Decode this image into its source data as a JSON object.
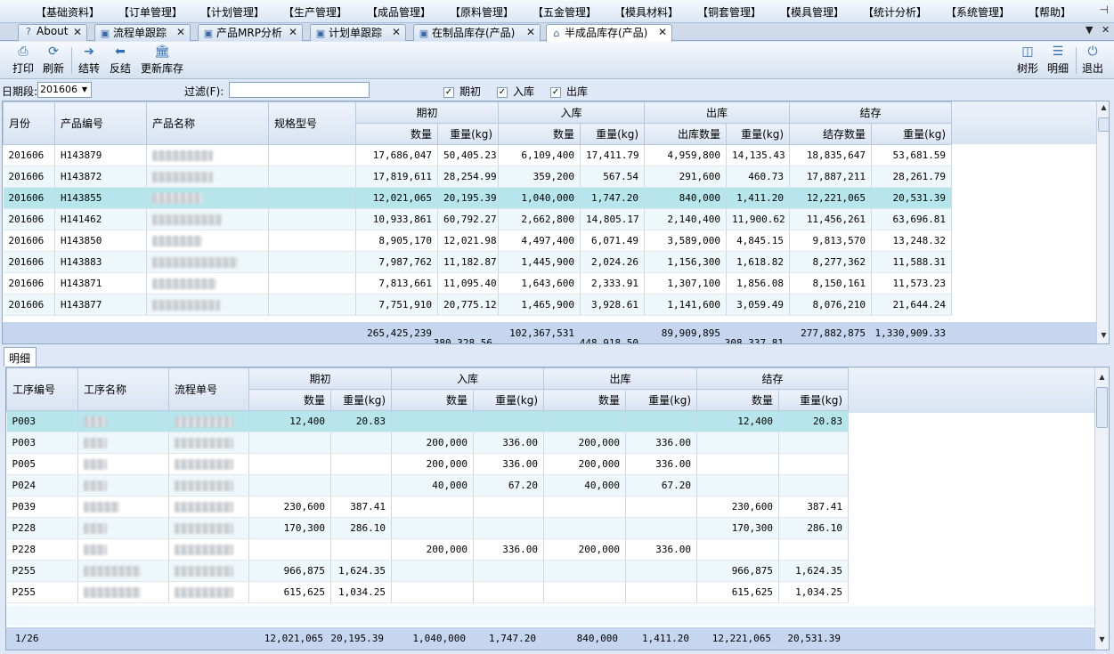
{
  "menu": [
    "【基础资料】",
    "【订单管理】",
    "【计划管理】",
    "【生产管理】",
    "【成品管理】",
    "【原料管理】",
    "【五金管理】",
    "【模具材料】",
    "【铜套管理】",
    "【模具管理】",
    "【统计分析】",
    "【系统管理】",
    "【帮助】"
  ],
  "menu_pin": "⊣",
  "tabs": [
    {
      "label": "About",
      "icon": "help-icon"
    },
    {
      "label": "流程单跟踪",
      "icon": "window-icon"
    },
    {
      "label": "产品MRP分析",
      "icon": "window-icon"
    },
    {
      "label": "计划单跟踪",
      "icon": "window-icon"
    },
    {
      "label": "在制品库存(产品)",
      "icon": "window-icon"
    },
    {
      "label": "半成品库存(产品)",
      "icon": "home-icon"
    }
  ],
  "toolbar": {
    "print": "打印",
    "refresh": "刷新",
    "carry": "结转",
    "reverse": "反结",
    "update": "更新库存",
    "tree": "树形",
    "detail": "明细",
    "exit": "退出"
  },
  "filter": {
    "period_label": "日期段:",
    "period_value": "201606",
    "filter_label": "过滤(F):",
    "filter_value": "",
    "chk_begin": "期初",
    "chk_in": "入库",
    "chk_out": "出库"
  },
  "top_grid": {
    "headers": {
      "month": "月份",
      "code": "产品编号",
      "name": "产品名称",
      "spec": "规格型号",
      "begin": "期初",
      "in": "入库",
      "out": "出库",
      "balance": "结存",
      "qty": "数量",
      "weight": "重量(kg)",
      "out_qty": "出库数量",
      "bal_qty": "结存数量"
    },
    "rows": [
      {
        "month": "201606",
        "code": "H143879",
        "bq": "17,686,047",
        "bw": "50,405.23",
        "iq": "6,109,400",
        "iw": "17,411.79",
        "oq": "4,959,800",
        "ow": "14,135.43",
        "sq": "18,835,647",
        "sw": "53,681.59",
        "nw": 68
      },
      {
        "month": "201606",
        "code": "H143872",
        "bq": "17,819,611",
        "bw": "28,254.99",
        "iq": "359,200",
        "iw": "567.54",
        "oq": "291,600",
        "ow": "460.73",
        "sq": "17,887,211",
        "sw": "28,261.79",
        "nw": 68
      },
      {
        "month": "201606",
        "code": "H143855",
        "bq": "12,021,065",
        "bw": "20,195.39",
        "iq": "1,040,000",
        "iw": "1,747.20",
        "oq": "840,000",
        "ow": "1,411.20",
        "sq": "12,221,065",
        "sw": "20,531.39",
        "nw": 56
      },
      {
        "month": "201606",
        "code": "H141462",
        "bq": "10,933,861",
        "bw": "60,792.27",
        "iq": "2,662,800",
        "iw": "14,805.17",
        "oq": "2,140,400",
        "ow": "11,900.62",
        "sq": "11,456,261",
        "sw": "63,696.81",
        "nw": 78
      },
      {
        "month": "201606",
        "code": "H143850",
        "bq": "8,905,170",
        "bw": "12,021.98",
        "iq": "4,497,400",
        "iw": "6,071.49",
        "oq": "3,589,000",
        "ow": "4,845.15",
        "sq": "9,813,570",
        "sw": "13,248.32",
        "nw": 56
      },
      {
        "month": "201606",
        "code": "H143883",
        "bq": "7,987,762",
        "bw": "11,182.87",
        "iq": "1,445,900",
        "iw": "2,024.26",
        "oq": "1,156,300",
        "ow": "1,618.82",
        "sq": "8,277,362",
        "sw": "11,588.31",
        "nw": 96
      },
      {
        "month": "201606",
        "code": "H143871",
        "bq": "7,813,661",
        "bw": "11,095.40",
        "iq": "1,643,600",
        "iw": "2,333.91",
        "oq": "1,307,100",
        "ow": "1,856.08",
        "sq": "8,150,161",
        "sw": "11,573.23",
        "nw": 72
      },
      {
        "month": "201606",
        "code": "H143877",
        "bq": "7,751,910",
        "bw": "20,775.12",
        "iq": "1,465,900",
        "iw": "3,928.61",
        "oq": "1,141,600",
        "ow": "3,059.49",
        "sq": "8,076,210",
        "sw": "21,644.24",
        "nw": 76
      }
    ],
    "totals": {
      "bq": "265,425,239",
      "bw": "380,328.56",
      "iq": "102,367,531",
      "iw": "448,918.50",
      "oq": "89,909,895",
      "ow": "308,337.81",
      "sq": "277,882,875",
      "sw": "1,330,909.33"
    }
  },
  "detail_tab": "明细",
  "bottom_grid": {
    "headers": {
      "proc_code": "工序编号",
      "proc_name": "工序名称",
      "flow_no": "流程单号",
      "begin": "期初",
      "in": "入库",
      "out": "出库",
      "balance": "结存",
      "qty": "数量",
      "weight": "重量(kg)"
    },
    "rows": [
      {
        "code": "P003",
        "bq": "12,400",
        "bw": "20.83",
        "iq": "",
        "iw": "",
        "oq": "",
        "ow": "",
        "sq": "12,400",
        "sw": "20.83",
        "nw": 26
      },
      {
        "code": "P003",
        "bq": "",
        "bw": "",
        "iq": "200,000",
        "iw": "336.00",
        "oq": "200,000",
        "ow": "336.00",
        "sq": "",
        "sw": "",
        "nw": 26
      },
      {
        "code": "P005",
        "bq": "",
        "bw": "",
        "iq": "200,000",
        "iw": "336.00",
        "oq": "200,000",
        "ow": "336.00",
        "sq": "",
        "sw": "",
        "nw": 26
      },
      {
        "code": "P024",
        "bq": "",
        "bw": "",
        "iq": "40,000",
        "iw": "67.20",
        "oq": "40,000",
        "ow": "67.20",
        "sq": "",
        "sw": "",
        "nw": 26
      },
      {
        "code": "P039",
        "bq": "230,600",
        "bw": "387.41",
        "iq": "",
        "iw": "",
        "oq": "",
        "ow": "",
        "sq": "230,600",
        "sw": "387.41",
        "nw": 40
      },
      {
        "code": "P228",
        "bq": "170,300",
        "bw": "286.10",
        "iq": "",
        "iw": "",
        "oq": "",
        "ow": "",
        "sq": "170,300",
        "sw": "286.10",
        "nw": 26
      },
      {
        "code": "P228",
        "bq": "",
        "bw": "",
        "iq": "200,000",
        "iw": "336.00",
        "oq": "200,000",
        "ow": "336.00",
        "sq": "",
        "sw": "",
        "nw": 26
      },
      {
        "code": "P255",
        "bq": "966,875",
        "bw": "1,624.35",
        "iq": "",
        "iw": "",
        "oq": "",
        "ow": "",
        "sq": "966,875",
        "sw": "1,624.35",
        "nw": 64
      },
      {
        "code": "P255",
        "bq": "615,625",
        "bw": "1,034.25",
        "iq": "",
        "iw": "",
        "oq": "",
        "ow": "",
        "sq": "615,625",
        "sw": "1,034.25",
        "nw": 64
      }
    ],
    "footer": {
      "page": "1/26",
      "bq": "12,021,065",
      "bw": "20,195.39",
      "iq": "1,040,000",
      "iw": "1,747.20",
      "oq": "840,000",
      "ow": "1,411.20",
      "sq": "12,221,065",
      "sw": "20,531.39"
    }
  }
}
